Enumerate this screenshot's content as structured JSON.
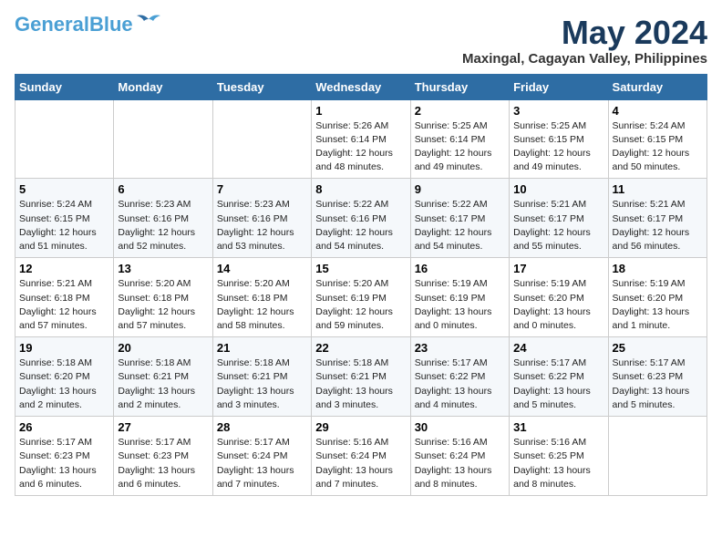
{
  "header": {
    "logo_general": "General",
    "logo_blue": "Blue",
    "month_year": "May 2024",
    "location": "Maxingal, Cagayan Valley, Philippines"
  },
  "weekdays": [
    "Sunday",
    "Monday",
    "Tuesday",
    "Wednesday",
    "Thursday",
    "Friday",
    "Saturday"
  ],
  "weeks": [
    [
      {
        "day": "",
        "sunrise": "",
        "sunset": "",
        "daylight": ""
      },
      {
        "day": "",
        "sunrise": "",
        "sunset": "",
        "daylight": ""
      },
      {
        "day": "",
        "sunrise": "",
        "sunset": "",
        "daylight": ""
      },
      {
        "day": "1",
        "sunrise": "Sunrise: 5:26 AM",
        "sunset": "Sunset: 6:14 PM",
        "daylight": "Daylight: 12 hours and 48 minutes."
      },
      {
        "day": "2",
        "sunrise": "Sunrise: 5:25 AM",
        "sunset": "Sunset: 6:14 PM",
        "daylight": "Daylight: 12 hours and 49 minutes."
      },
      {
        "day": "3",
        "sunrise": "Sunrise: 5:25 AM",
        "sunset": "Sunset: 6:15 PM",
        "daylight": "Daylight: 12 hours and 49 minutes."
      },
      {
        "day": "4",
        "sunrise": "Sunrise: 5:24 AM",
        "sunset": "Sunset: 6:15 PM",
        "daylight": "Daylight: 12 hours and 50 minutes."
      }
    ],
    [
      {
        "day": "5",
        "sunrise": "Sunrise: 5:24 AM",
        "sunset": "Sunset: 6:15 PM",
        "daylight": "Daylight: 12 hours and 51 minutes."
      },
      {
        "day": "6",
        "sunrise": "Sunrise: 5:23 AM",
        "sunset": "Sunset: 6:16 PM",
        "daylight": "Daylight: 12 hours and 52 minutes."
      },
      {
        "day": "7",
        "sunrise": "Sunrise: 5:23 AM",
        "sunset": "Sunset: 6:16 PM",
        "daylight": "Daylight: 12 hours and 53 minutes."
      },
      {
        "day": "8",
        "sunrise": "Sunrise: 5:22 AM",
        "sunset": "Sunset: 6:16 PM",
        "daylight": "Daylight: 12 hours and 54 minutes."
      },
      {
        "day": "9",
        "sunrise": "Sunrise: 5:22 AM",
        "sunset": "Sunset: 6:17 PM",
        "daylight": "Daylight: 12 hours and 54 minutes."
      },
      {
        "day": "10",
        "sunrise": "Sunrise: 5:21 AM",
        "sunset": "Sunset: 6:17 PM",
        "daylight": "Daylight: 12 hours and 55 minutes."
      },
      {
        "day": "11",
        "sunrise": "Sunrise: 5:21 AM",
        "sunset": "Sunset: 6:17 PM",
        "daylight": "Daylight: 12 hours and 56 minutes."
      }
    ],
    [
      {
        "day": "12",
        "sunrise": "Sunrise: 5:21 AM",
        "sunset": "Sunset: 6:18 PM",
        "daylight": "Daylight: 12 hours and 57 minutes."
      },
      {
        "day": "13",
        "sunrise": "Sunrise: 5:20 AM",
        "sunset": "Sunset: 6:18 PM",
        "daylight": "Daylight: 12 hours and 57 minutes."
      },
      {
        "day": "14",
        "sunrise": "Sunrise: 5:20 AM",
        "sunset": "Sunset: 6:18 PM",
        "daylight": "Daylight: 12 hours and 58 minutes."
      },
      {
        "day": "15",
        "sunrise": "Sunrise: 5:20 AM",
        "sunset": "Sunset: 6:19 PM",
        "daylight": "Daylight: 12 hours and 59 minutes."
      },
      {
        "day": "16",
        "sunrise": "Sunrise: 5:19 AM",
        "sunset": "Sunset: 6:19 PM",
        "daylight": "Daylight: 13 hours and 0 minutes."
      },
      {
        "day": "17",
        "sunrise": "Sunrise: 5:19 AM",
        "sunset": "Sunset: 6:20 PM",
        "daylight": "Daylight: 13 hours and 0 minutes."
      },
      {
        "day": "18",
        "sunrise": "Sunrise: 5:19 AM",
        "sunset": "Sunset: 6:20 PM",
        "daylight": "Daylight: 13 hours and 1 minute."
      }
    ],
    [
      {
        "day": "19",
        "sunrise": "Sunrise: 5:18 AM",
        "sunset": "Sunset: 6:20 PM",
        "daylight": "Daylight: 13 hours and 2 minutes."
      },
      {
        "day": "20",
        "sunrise": "Sunrise: 5:18 AM",
        "sunset": "Sunset: 6:21 PM",
        "daylight": "Daylight: 13 hours and 2 minutes."
      },
      {
        "day": "21",
        "sunrise": "Sunrise: 5:18 AM",
        "sunset": "Sunset: 6:21 PM",
        "daylight": "Daylight: 13 hours and 3 minutes."
      },
      {
        "day": "22",
        "sunrise": "Sunrise: 5:18 AM",
        "sunset": "Sunset: 6:21 PM",
        "daylight": "Daylight: 13 hours and 3 minutes."
      },
      {
        "day": "23",
        "sunrise": "Sunrise: 5:17 AM",
        "sunset": "Sunset: 6:22 PM",
        "daylight": "Daylight: 13 hours and 4 minutes."
      },
      {
        "day": "24",
        "sunrise": "Sunrise: 5:17 AM",
        "sunset": "Sunset: 6:22 PM",
        "daylight": "Daylight: 13 hours and 5 minutes."
      },
      {
        "day": "25",
        "sunrise": "Sunrise: 5:17 AM",
        "sunset": "Sunset: 6:23 PM",
        "daylight": "Daylight: 13 hours and 5 minutes."
      }
    ],
    [
      {
        "day": "26",
        "sunrise": "Sunrise: 5:17 AM",
        "sunset": "Sunset: 6:23 PM",
        "daylight": "Daylight: 13 hours and 6 minutes."
      },
      {
        "day": "27",
        "sunrise": "Sunrise: 5:17 AM",
        "sunset": "Sunset: 6:23 PM",
        "daylight": "Daylight: 13 hours and 6 minutes."
      },
      {
        "day": "28",
        "sunrise": "Sunrise: 5:17 AM",
        "sunset": "Sunset: 6:24 PM",
        "daylight": "Daylight: 13 hours and 7 minutes."
      },
      {
        "day": "29",
        "sunrise": "Sunrise: 5:16 AM",
        "sunset": "Sunset: 6:24 PM",
        "daylight": "Daylight: 13 hours and 7 minutes."
      },
      {
        "day": "30",
        "sunrise": "Sunrise: 5:16 AM",
        "sunset": "Sunset: 6:24 PM",
        "daylight": "Daylight: 13 hours and 8 minutes."
      },
      {
        "day": "31",
        "sunrise": "Sunrise: 5:16 AM",
        "sunset": "Sunset: 6:25 PM",
        "daylight": "Daylight: 13 hours and 8 minutes."
      },
      {
        "day": "",
        "sunrise": "",
        "sunset": "",
        "daylight": ""
      }
    ]
  ]
}
